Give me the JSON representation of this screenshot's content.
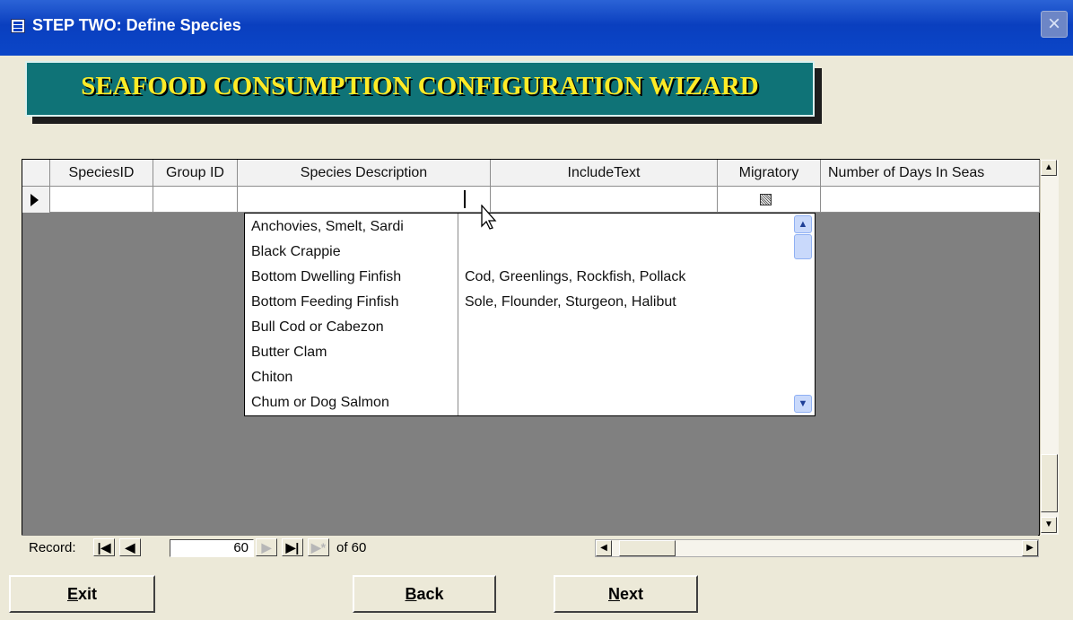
{
  "window": {
    "title": "STEP TWO:  Define Species",
    "close": "×"
  },
  "banner": {
    "text": "SEAFOOD CONSUMPTION CONFIGURATION WIZARD"
  },
  "grid": {
    "columns": [
      "SpeciesID",
      "Group ID",
      "Species Description",
      "IncludeText",
      "Migratory",
      "Number of Days In Seas"
    ],
    "row": {
      "species_id": "",
      "group_id": "",
      "species_description": "",
      "include_text": "",
      "migratory_checked": true,
      "days": ""
    }
  },
  "dropdown": {
    "items": [
      {
        "name": "Anchovies, Smelt, Sardi",
        "include": ""
      },
      {
        "name": "Black Crappie",
        "include": ""
      },
      {
        "name": "Bottom Dwelling Finfish",
        "include": "Cod, Greenlings, Rockfish, Pollack"
      },
      {
        "name": "Bottom Feeding Finfish",
        "include": "Sole, Flounder, Sturgeon, Halibut"
      },
      {
        "name": "Bull Cod or Cabezon",
        "include": ""
      },
      {
        "name": "Butter Clam",
        "include": ""
      },
      {
        "name": "Chiton",
        "include": ""
      },
      {
        "name": "Chum or Dog Salmon",
        "include": ""
      }
    ]
  },
  "navigation": {
    "record_label": "Record:",
    "current": "60",
    "of_label": "of 60"
  },
  "buttons": {
    "exit_u": "E",
    "exit_rest": "xit",
    "back_u": "B",
    "back_rest": "ack",
    "next_u": "N",
    "next_rest": "ext"
  }
}
